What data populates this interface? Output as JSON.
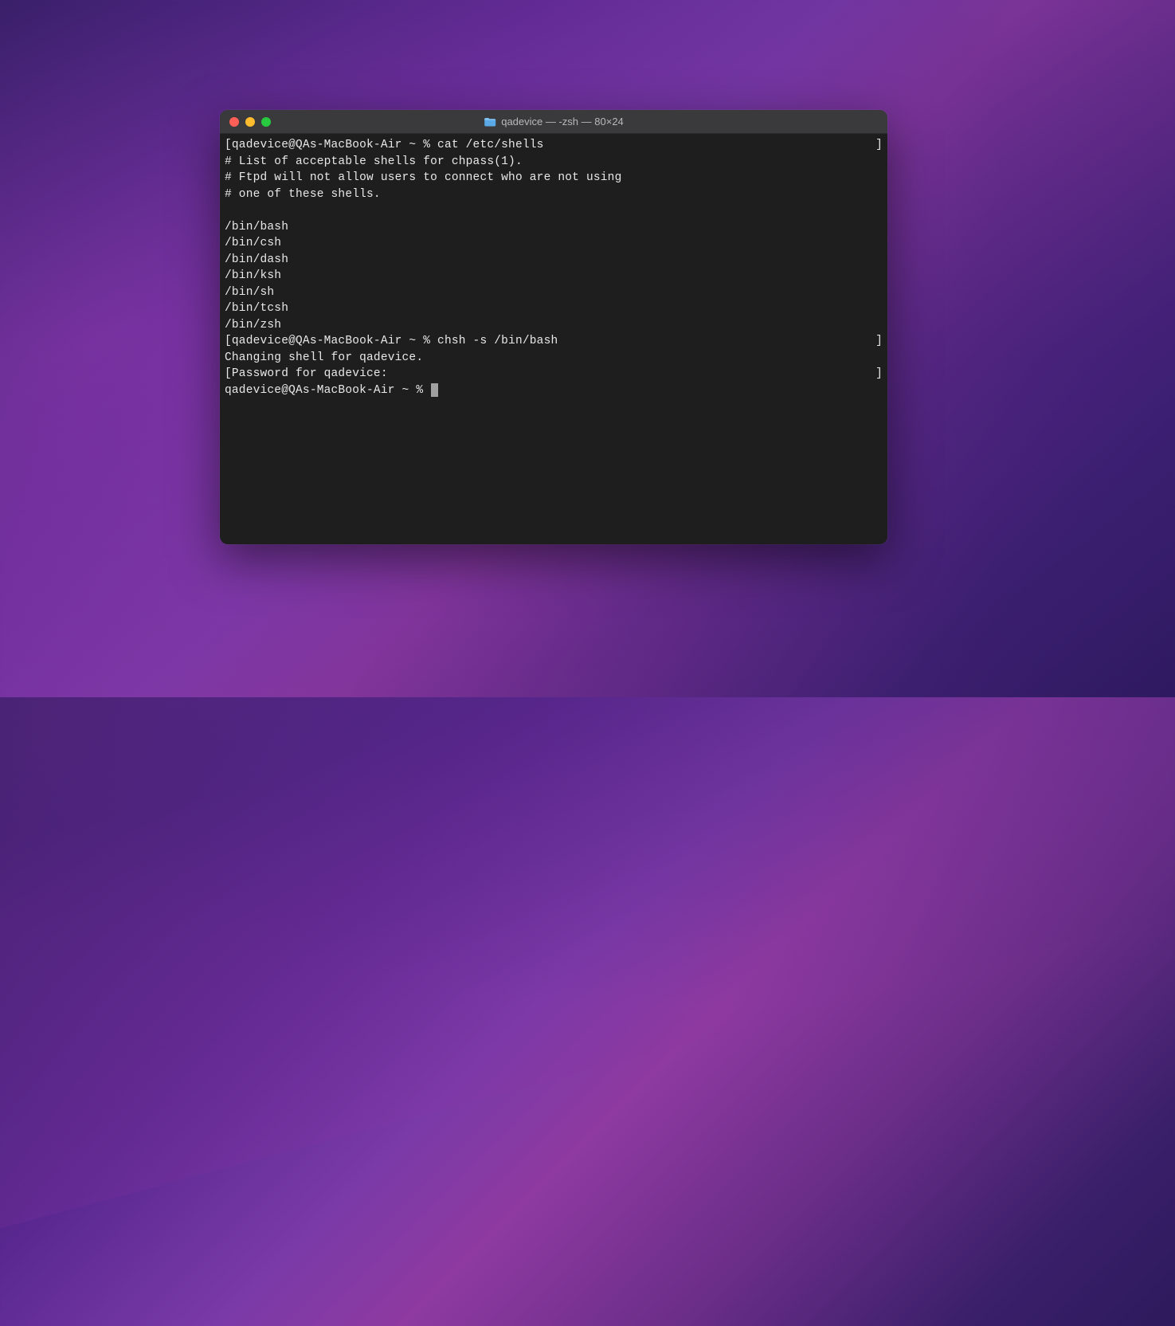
{
  "window": {
    "title": "qadevice — -zsh — 80×24"
  },
  "terminal": {
    "lines": [
      {
        "left": "[qadevice@QAs-MacBook-Air ~ % cat /etc/shells",
        "right": "]"
      },
      {
        "text": "# List of acceptable shells for chpass(1)."
      },
      {
        "text": "# Ftpd will not allow users to connect who are not using"
      },
      {
        "text": "# one of these shells."
      },
      {
        "text": ""
      },
      {
        "text": "/bin/bash"
      },
      {
        "text": "/bin/csh"
      },
      {
        "text": "/bin/dash"
      },
      {
        "text": "/bin/ksh"
      },
      {
        "text": "/bin/sh"
      },
      {
        "text": "/bin/tcsh"
      },
      {
        "text": "/bin/zsh"
      },
      {
        "left": "[qadevice@QAs-MacBook-Air ~ % chsh -s /bin/bash",
        "right": "]"
      },
      {
        "text": "Changing shell for qadevice."
      },
      {
        "left": "[Password for qadevice:",
        "right": "]"
      },
      {
        "text": "qadevice@QAs-MacBook-Air ~ % ",
        "cursor": true
      }
    ]
  }
}
